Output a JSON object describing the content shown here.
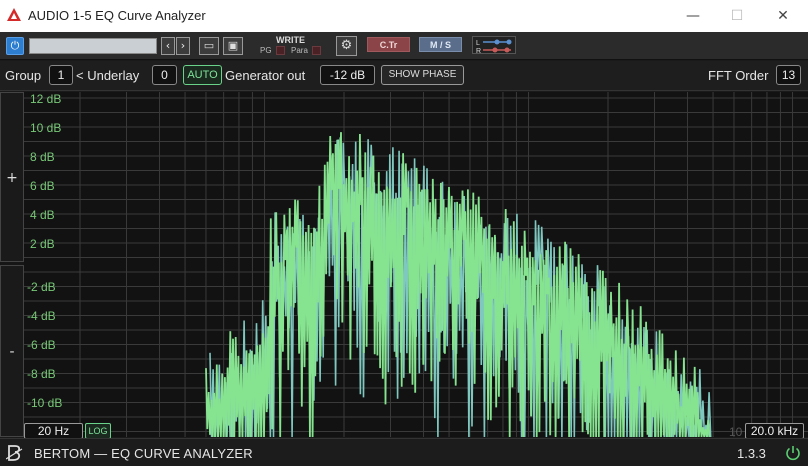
{
  "window": {
    "title": "AUDIO 1-5 EQ Curve Analyzer",
    "minimize_icon": "minimize-icon",
    "maximize_icon": "maximize-icon",
    "close_icon": "close-icon"
  },
  "toolbar": {
    "preset_value": "",
    "write_label": "WRITE",
    "pg_label": "PG",
    "para_label": "Para",
    "ctr_label": "C.Tr",
    "ms_label": "M / S",
    "lr_l": "L",
    "lr_r": "R"
  },
  "controls": {
    "group_label": "Group",
    "group_value": "1",
    "underlay_label": "< Underlay",
    "underlay_value": "0",
    "auto_label": "AUTO",
    "generator_label": "Generator out",
    "generator_value": "-12 dB",
    "show_phase_label": "SHOW PHASE",
    "fft_order_label": "FFT Order",
    "fft_order_value": "13"
  },
  "zoom": {
    "plus_label": "+",
    "minus_label": "-"
  },
  "graph": {
    "db_labels": [
      "12 dB",
      "10 dB",
      "8 dB",
      "6 dB",
      "4 dB",
      "2 dB",
      "-2 dB",
      "-4 dB",
      "-6 dB",
      "-8 dB",
      "-10 dB"
    ],
    "freq_min": "20 Hz",
    "freq_max": "20.0 kHz",
    "log_label": "LOG",
    "ghost_label": "10",
    "colors": {
      "curve_primary": "#86e38f",
      "curve_secondary": "#7fc8c0",
      "grid": "#3a3a3a",
      "label": "#78c878"
    }
  },
  "footer": {
    "title": "BERTOM — EQ CURVE ANALYZER",
    "version": "1.3.3",
    "power_icon": "power-icon"
  }
}
